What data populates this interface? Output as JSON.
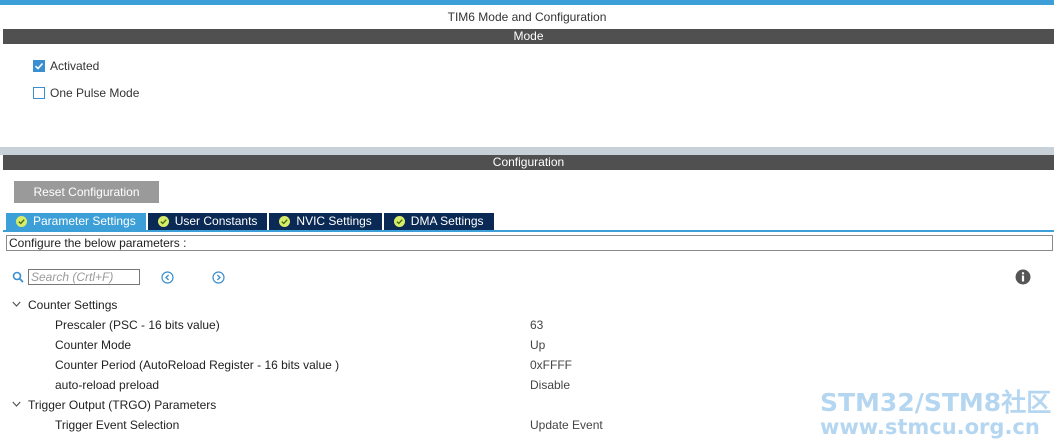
{
  "window": {
    "title": "TIM6 Mode and Configuration"
  },
  "mode": {
    "header": "Mode",
    "options": [
      {
        "label": "Activated",
        "checked": true
      },
      {
        "label": "One Pulse Mode",
        "checked": false
      }
    ]
  },
  "config": {
    "header": "Configuration",
    "reset_label": "Reset Configuration",
    "tabs": [
      {
        "label": "Parameter Settings",
        "active": true
      },
      {
        "label": "User Constants",
        "active": false
      },
      {
        "label": "NVIC Settings",
        "active": false
      },
      {
        "label": "DMA Settings",
        "active": false
      }
    ],
    "describe": "Configure the below parameters :",
    "search_placeholder": "Search (Crtl+F)",
    "groups": [
      {
        "label": "Counter Settings",
        "params": [
          {
            "name": "Prescaler (PSC - 16 bits value)",
            "value": "63"
          },
          {
            "name": "Counter Mode",
            "value": "Up"
          },
          {
            "name": "Counter Period (AutoReload Register - 16 bits value )",
            "value": "0xFFFF"
          },
          {
            "name": "auto-reload preload",
            "value": "Disable"
          }
        ]
      },
      {
        "label": "Trigger Output (TRGO) Parameters",
        "params": [
          {
            "name": "Trigger Event Selection",
            "value": "Update Event"
          }
        ]
      }
    ]
  },
  "watermark": {
    "line1": "STM32/STM8社区",
    "line2": "www.stmcu.org.cn"
  },
  "colors": {
    "accent": "#3c9fd8",
    "tab_dark": "#0a2a55",
    "header_bg": "#505050",
    "check_ok": "#d8ec6a"
  }
}
